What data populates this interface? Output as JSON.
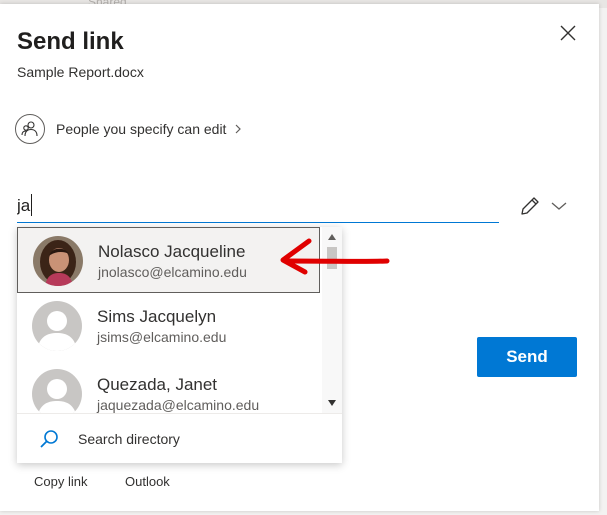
{
  "background": {
    "hint_text": "Shared"
  },
  "dialog": {
    "title": "Send link",
    "filename": "Sample Report.docx",
    "permission": {
      "label": "People you specify can edit",
      "icon": "people-settings-icon"
    },
    "recipient_input": {
      "value": "ja",
      "placeholder": ""
    },
    "send_label": "Send",
    "bottom_links": [
      "Copy link",
      "Outlook"
    ]
  },
  "suggestions": {
    "items": [
      {
        "name": "Nolasco Jacqueline",
        "email": "jnolasco@elcamino.edu",
        "avatar": "photo",
        "selected": true
      },
      {
        "name": "Sims Jacquelyn",
        "email": "jsims@elcamino.edu",
        "avatar": "placeholder",
        "selected": false
      },
      {
        "name": "Quezada, Janet",
        "email": "jaquezada@elcamino.edu",
        "avatar": "placeholder",
        "selected": false
      }
    ],
    "search_directory_label": "Search directory"
  },
  "colors": {
    "accent": "#0078d4",
    "annotation": "#e00000",
    "text": "#323130"
  }
}
